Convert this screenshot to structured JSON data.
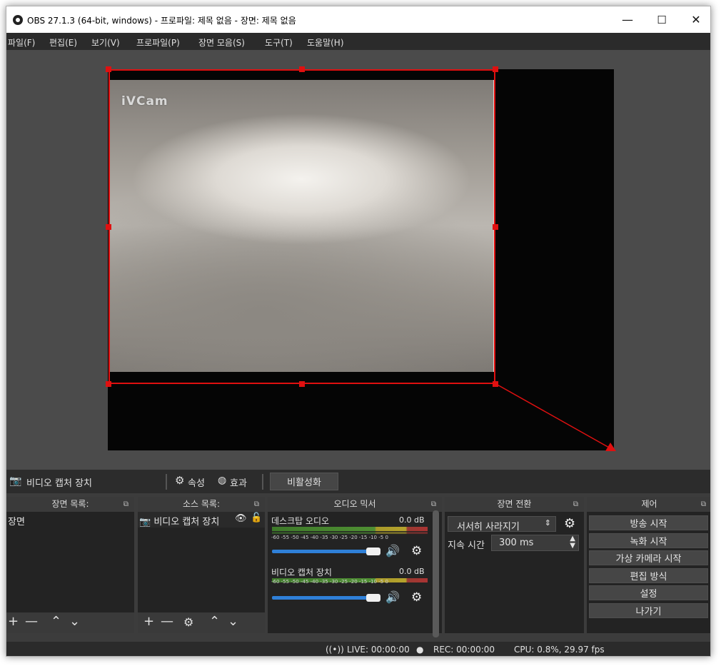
{
  "window": {
    "title": "OBS 27.1.3 (64-bit, windows) - 프로파일: 제목 없음 - 장면: 제목 없음",
    "minimize": "—",
    "maximize": "☐",
    "close": "✕"
  },
  "menu": [
    "파일(F)",
    "편집(E)",
    "보기(V)",
    "프로파일(P)",
    "장면 모음(S)",
    "도구(T)",
    "도움말(H)"
  ],
  "preview": {
    "watermark": "iVCam",
    "selection_color": "#e01010"
  },
  "source_toolbar": {
    "source_name": "비디오 캡처 장치",
    "properties": "속성",
    "filters": "효과",
    "deactivate": "비활성화"
  },
  "docks": {
    "scenes": {
      "title": "장면 목록:",
      "items": [
        "장면"
      ]
    },
    "sources": {
      "title": "소스 목록:",
      "items": [
        "비디오 캡처 장치"
      ]
    },
    "mixer": {
      "title": "오디오 믹서",
      "channels": [
        {
          "name": "데스크탑 오디오",
          "db": "0.0 dB"
        },
        {
          "name": "비디오 캡처 장치",
          "db": "0.0 dB"
        }
      ],
      "ticks": "-60 -55 -50 -45 -40 -35 -30 -25 -20 -15 -10 -5 0"
    },
    "transitions": {
      "title": "장면 전환",
      "selected": "서서히 사라지기",
      "duration_label": "지속 시간",
      "duration_value": "300 ms"
    },
    "controls": {
      "title": "제어",
      "buttons": [
        "방송 시작",
        "녹화 시작",
        "가상 카메라 시작",
        "편집 방식",
        "설정",
        "나가기"
      ]
    }
  },
  "status": {
    "live": "LIVE: 00:00:00",
    "rec": "REC: 00:00:00",
    "cpu": "CPU: 0.8%, 29.97 fps"
  },
  "colors": {
    "accent": "#2f80d8",
    "meter_green": "#4f8f33",
    "meter_yellow": "#b5a22c",
    "meter_red": "#a33333"
  }
}
